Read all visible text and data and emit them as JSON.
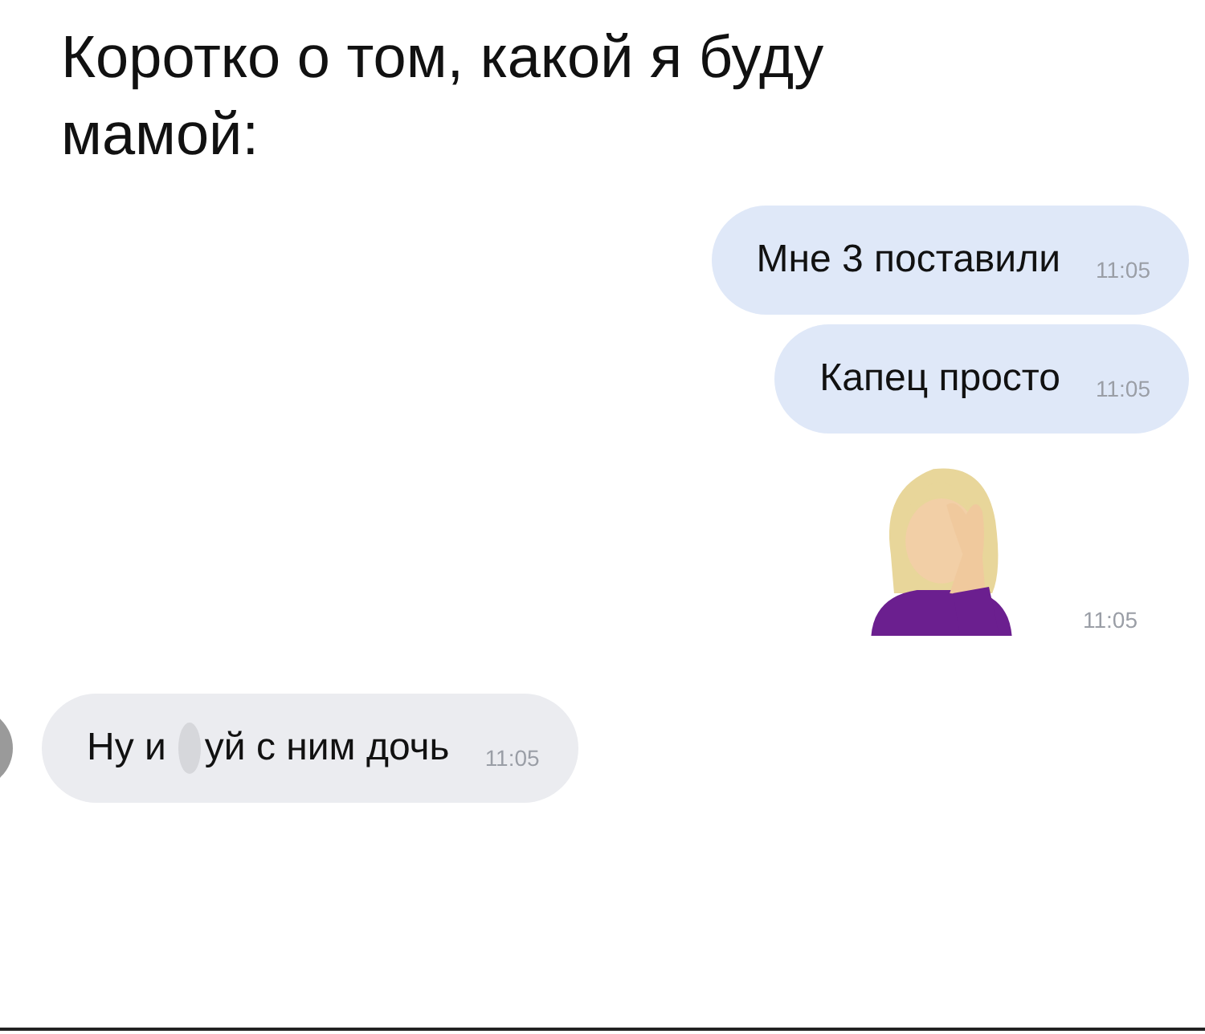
{
  "caption": "Коротко о том, какой я буду мамой:",
  "messages": [
    {
      "kind": "text",
      "outgoing": true,
      "text": "Мне 3 поставили",
      "time": "11:05"
    },
    {
      "kind": "text",
      "outgoing": true,
      "text": "Капец просто",
      "time": "11:05"
    },
    {
      "kind": "emoji",
      "outgoing": true,
      "time": "11:05"
    },
    {
      "kind": "censored",
      "outgoing": false,
      "parts": [
        "Ну и",
        "уй с ним дочь"
      ],
      "time": "11:05"
    }
  ]
}
